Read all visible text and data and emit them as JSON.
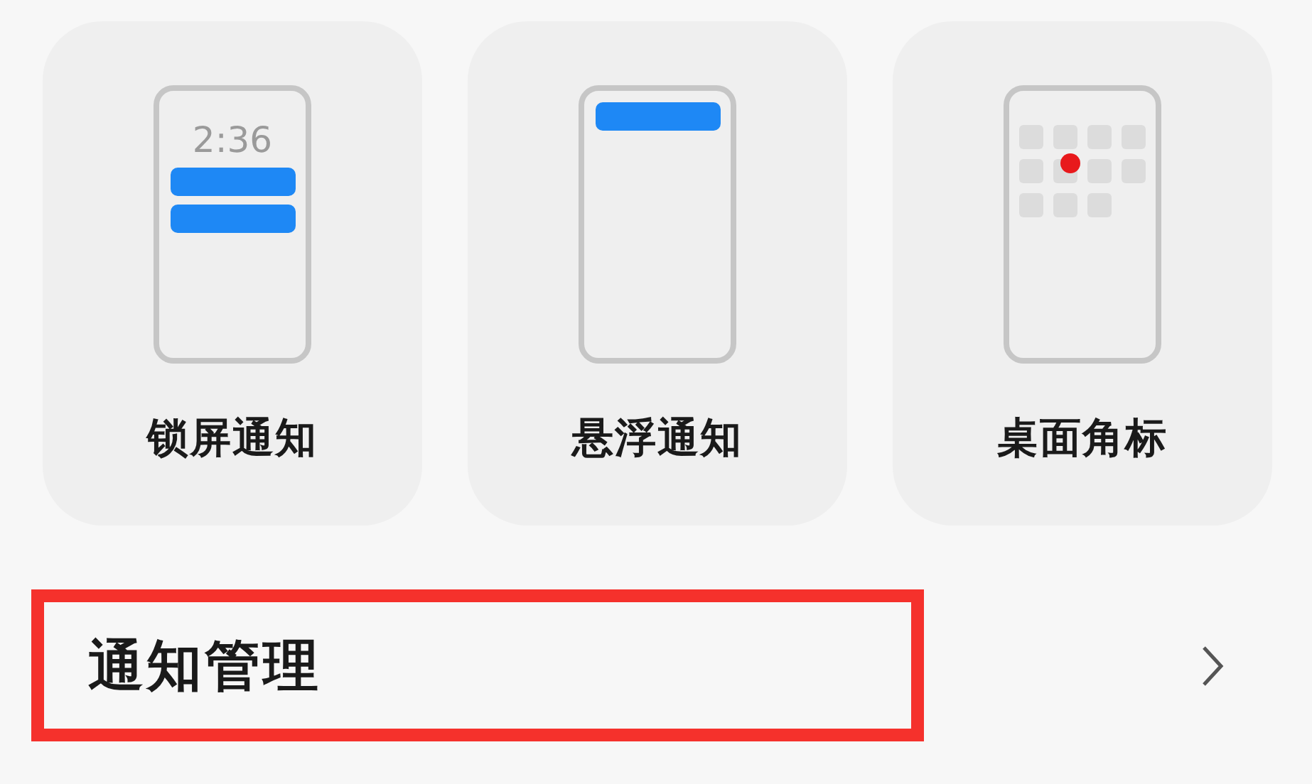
{
  "cards": [
    {
      "kind": "lockscreen",
      "label": "锁屏通知",
      "time": "2:36"
    },
    {
      "kind": "banner",
      "label": "悬浮通知"
    },
    {
      "kind": "badge",
      "label": "桌面角标"
    }
  ],
  "row": {
    "title": "通知管理",
    "highlighted": true
  }
}
